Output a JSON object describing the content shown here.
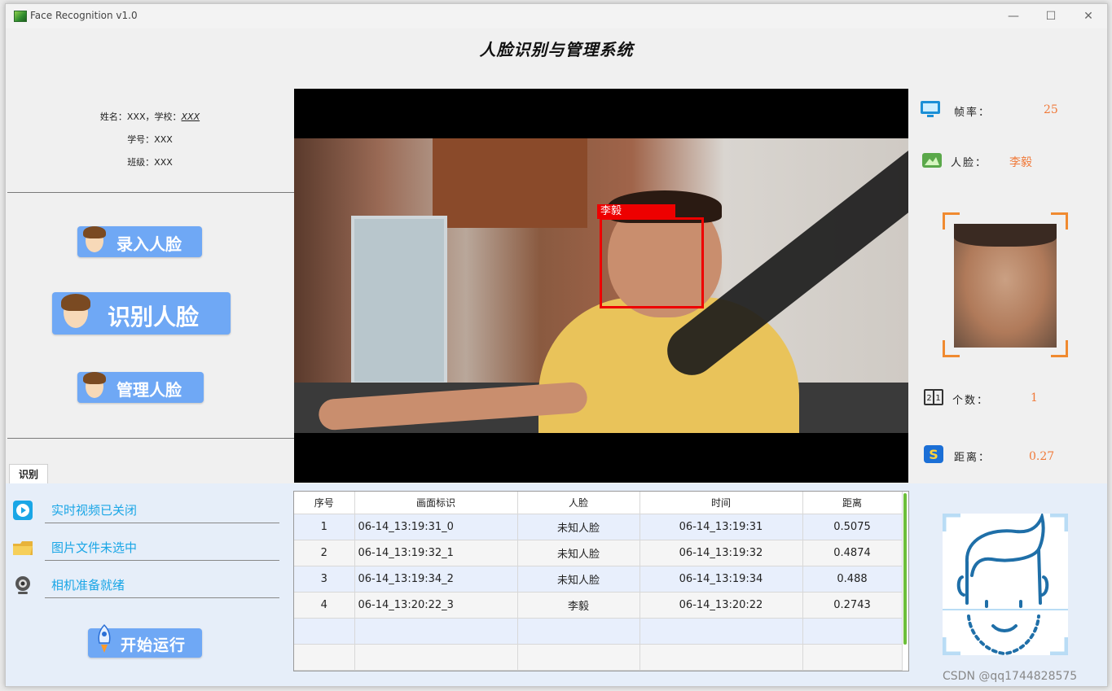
{
  "window": {
    "title": "Face Recognition v1.0"
  },
  "header": {
    "title": "人脸识别与管理系统"
  },
  "student": {
    "name_label": "姓名：XXX，学校：",
    "school": "XXX",
    "id_line": "学号：XXX",
    "class_line": "班级：XXX"
  },
  "actions": {
    "enroll": "录入人脸",
    "recognize": "识别人脸",
    "manage": "管理人脸",
    "start": "开始运行"
  },
  "video": {
    "face_tag": "李毅"
  },
  "stats": {
    "fps_label": "帧率：",
    "fps_value": "25",
    "face_label": "人脸：",
    "face_value": "李毅",
    "count_label": "个数：",
    "count_value": "1",
    "distance_label": "距离：",
    "distance_value": "0.27"
  },
  "tab": {
    "label": "识别"
  },
  "status": {
    "video": "实时视频已关闭",
    "image": "图片文件未选中",
    "camera": "相机准备就绪"
  },
  "table": {
    "headers": [
      "序号",
      "画面标识",
      "人脸",
      "时间",
      "距离"
    ],
    "rows": [
      [
        "1",
        "06-14_13:19:31_0",
        "未知人脸",
        "06-14_13:19:31",
        "0.5075"
      ],
      [
        "2",
        "06-14_13:19:32_1",
        "未知人脸",
        "06-14_13:19:32",
        "0.4874"
      ],
      [
        "3",
        "06-14_13:19:34_2",
        "未知人脸",
        "06-14_13:19:34",
        "0.488"
      ],
      [
        "4",
        "06-14_13:20:22_3",
        "李毅",
        "06-14_13:20:22",
        "0.2743"
      ]
    ]
  },
  "watermark": "CSDN @qq1744828575",
  "colors": {
    "accent": "#6fa8f5",
    "value": "#f07a3a",
    "status": "#1aa6e6",
    "box": "#e00000"
  }
}
